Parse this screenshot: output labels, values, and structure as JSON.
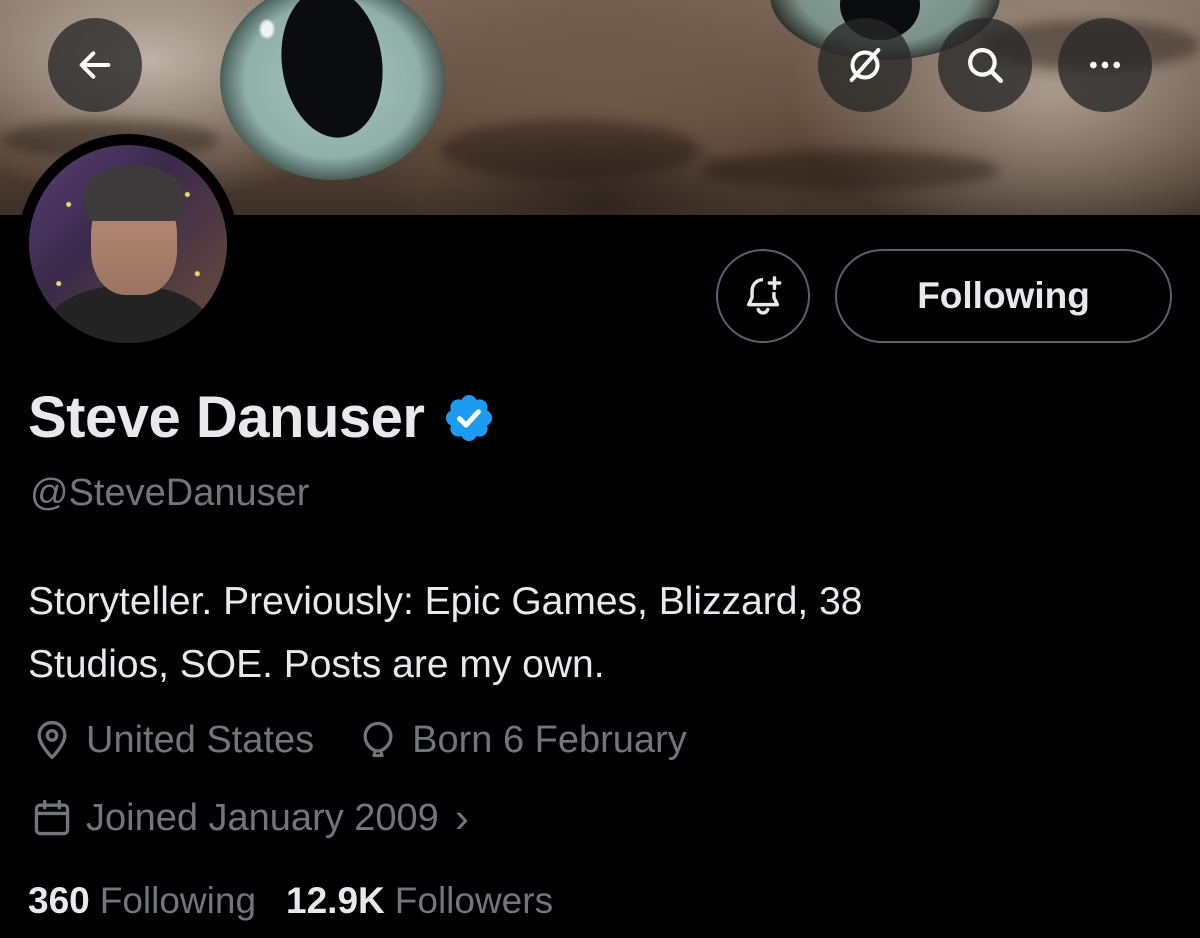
{
  "header": {
    "back_icon": "arrow-left-icon",
    "grok_icon": "grok-icon",
    "search_icon": "search-icon",
    "more_icon": "ellipsis-icon"
  },
  "profile": {
    "display_name": "Steve Danuser",
    "handle": "@SteveDanuser",
    "verified": true,
    "verified_color": "#1d9bf0",
    "bio_line1": "Storyteller. Previously: Epic Games, Blizzard, 38",
    "bio_line2": "Studios, SOE. Posts are my own.",
    "location": "United States",
    "birthday": "Born 6 February",
    "joined": "Joined January 2009",
    "joined_chevron": "›"
  },
  "actions": {
    "notify_icon": "bell-plus-icon",
    "following_label": "Following"
  },
  "stats": {
    "following_count": "360",
    "following_label": "Following",
    "followers_count": "12.9K",
    "followers_label": "Followers"
  },
  "colors": {
    "background": "#000000",
    "primary_text": "#e7e9ea",
    "secondary_text": "#71767b",
    "border": "#536471",
    "accent": "#1d9bf0"
  }
}
